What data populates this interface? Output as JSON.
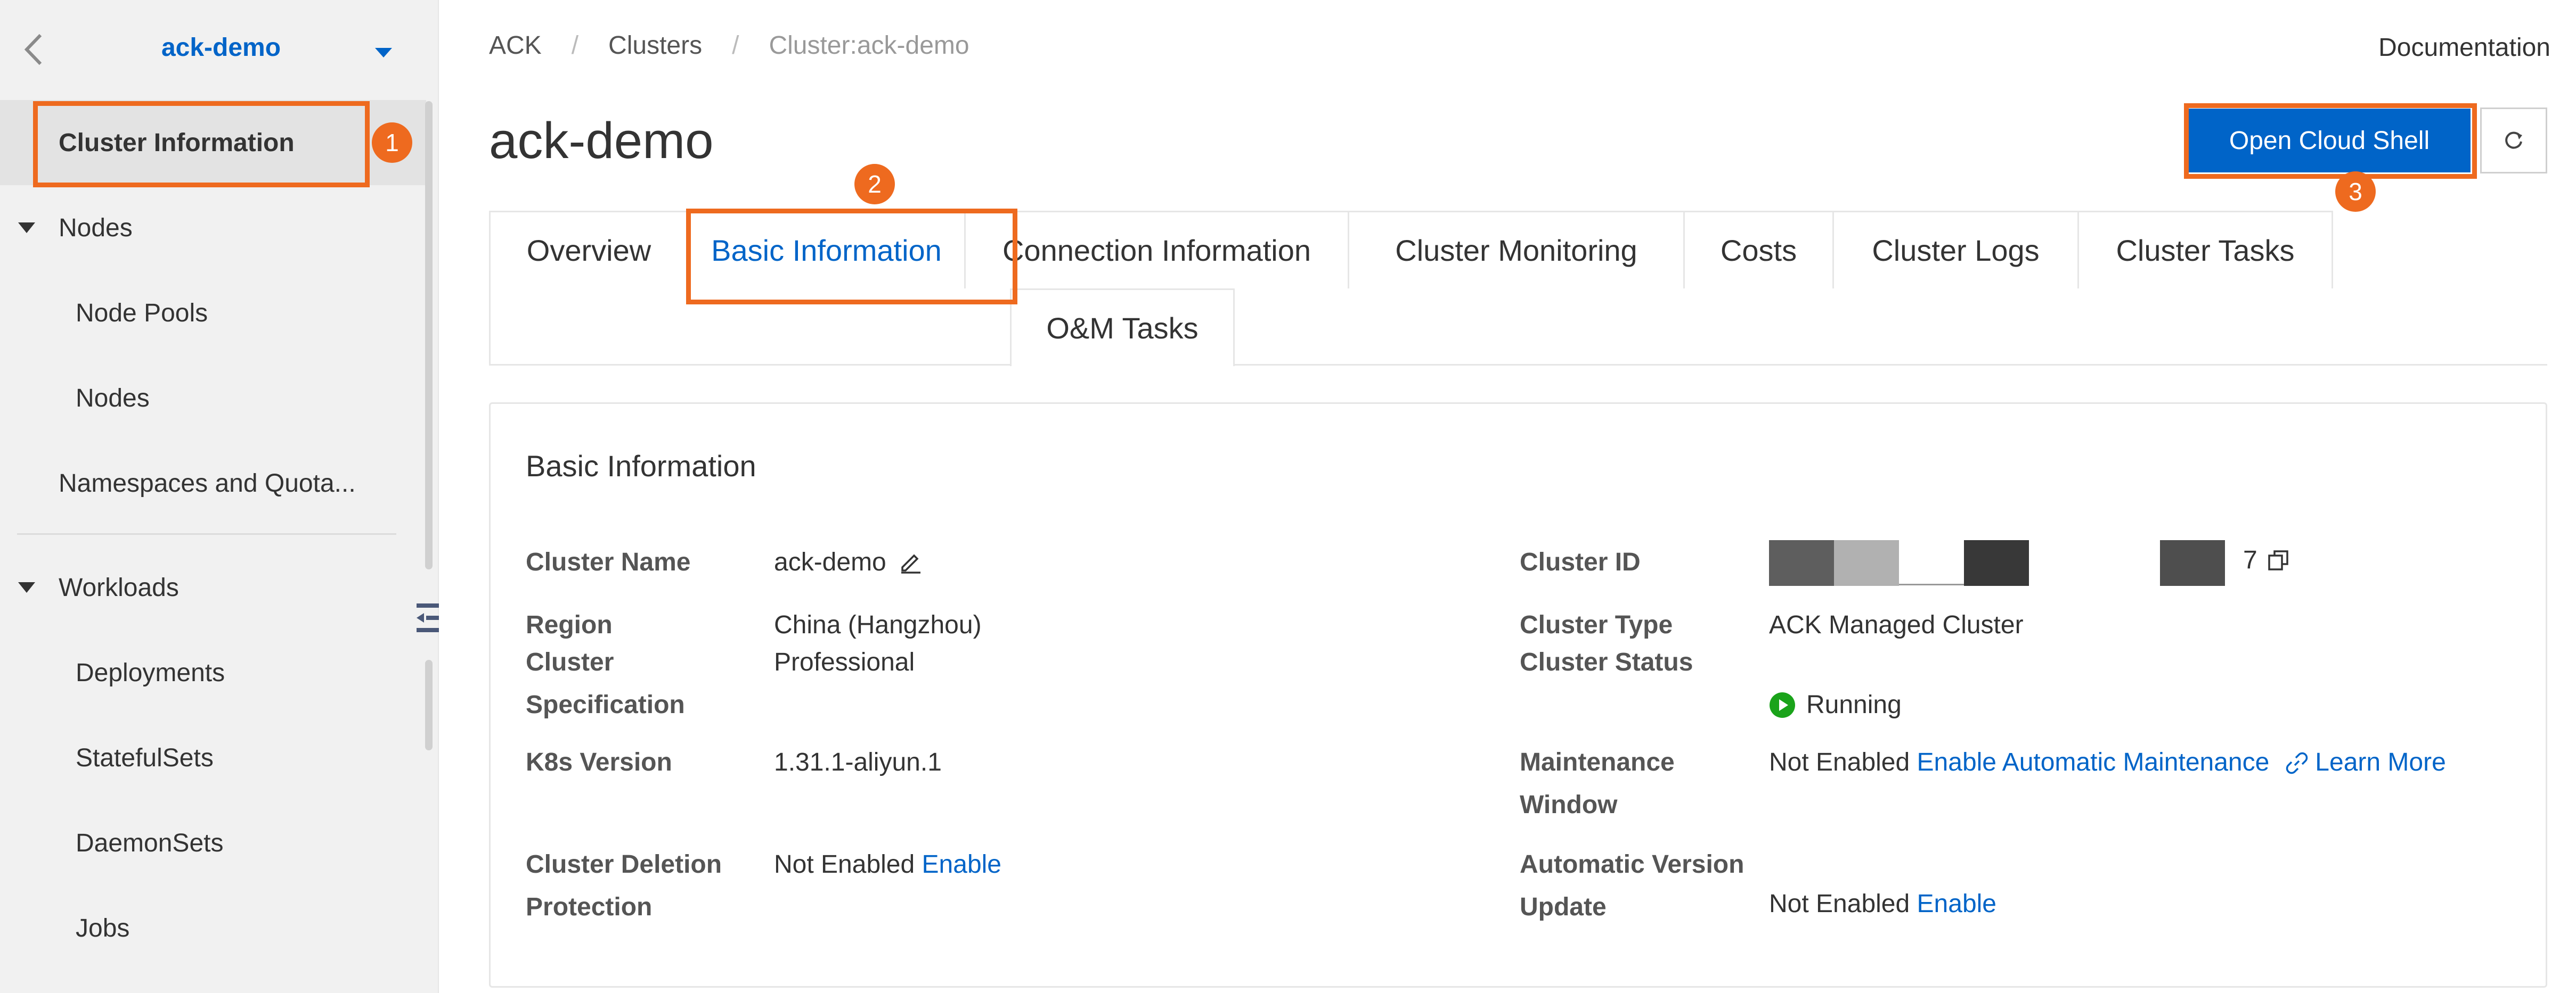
{
  "sidebar": {
    "cluster_name": "ack-demo",
    "items": [
      {
        "label": "Cluster Information"
      },
      {
        "label": "Nodes"
      },
      {
        "label": "Node Pools"
      },
      {
        "label": "Nodes"
      },
      {
        "label": "Namespaces and Quota..."
      },
      {
        "label": "Workloads"
      },
      {
        "label": "Deployments"
      },
      {
        "label": "StatefulSets"
      },
      {
        "label": "DaemonSets"
      },
      {
        "label": "Jobs"
      }
    ]
  },
  "callouts": [
    "1",
    "2",
    "3"
  ],
  "breadcrumb": [
    "ACK",
    "Clusters",
    "Cluster:ack-demo"
  ],
  "header": {
    "documentation": "Documentation",
    "title": "ack-demo",
    "open_cloud_shell": "Open Cloud Shell"
  },
  "tabs": [
    {
      "label": "Overview"
    },
    {
      "label": "Basic Information"
    },
    {
      "label": "Connection Information"
    },
    {
      "label": "Cluster Monitoring"
    },
    {
      "label": "Costs"
    },
    {
      "label": "Cluster Logs"
    },
    {
      "label": "Cluster Tasks"
    },
    {
      "label": "O&M Tasks"
    }
  ],
  "basic_info": {
    "title": "Basic Information",
    "cluster_name_label": "Cluster Name",
    "cluster_name_value": "ack-demo",
    "region_label": "Region",
    "region_value": "China (Hangzhou)",
    "spec_label_1": "Cluster",
    "spec_label_2": "Specification",
    "spec_value": "Professional",
    "k8s_label": "K8s Version",
    "k8s_value": "1.31.1-aliyun.1",
    "deletion_label_1": "Cluster Deletion",
    "deletion_label_2": "Protection",
    "deletion_value": "Not Enabled",
    "deletion_link": "Enable",
    "cluster_id_label": "Cluster ID",
    "cluster_id_suffix": "7",
    "cluster_type_label": "Cluster Type",
    "cluster_type_value": "ACK Managed Cluster",
    "cluster_status_label": "Cluster Status",
    "cluster_status_value": "Running",
    "maint_label_1": "Maintenance",
    "maint_label_2": "Window",
    "maint_value": "Not Enabled",
    "maint_link": "Enable Automatic Maintenance",
    "maint_learn_more": "Learn More",
    "auto_update_label_1": "Automatic Version",
    "auto_update_label_2": "Update",
    "auto_update_value": "Not Enabled",
    "auto_update_link": "Enable"
  },
  "colors": {
    "accent": "#0064c8",
    "callout": "#ee6a1f",
    "running": "#1aa31a"
  }
}
